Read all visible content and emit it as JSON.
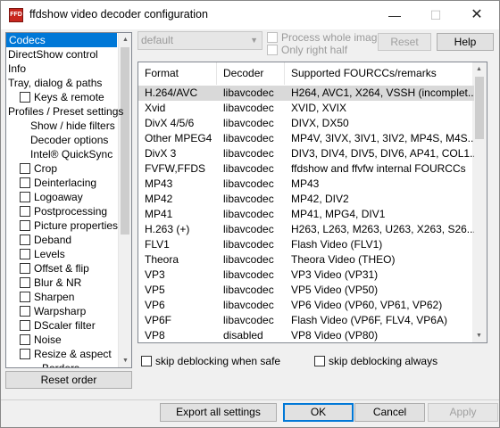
{
  "window": {
    "title": "ffdshow video decoder configuration",
    "icon_text": "FFD"
  },
  "titlebar_buttons": {
    "minimize": "—",
    "maximize": "☐",
    "close": "✕"
  },
  "tree": {
    "items": [
      {
        "label": "Codecs",
        "selected": true,
        "checkbox": false,
        "indent": 0
      },
      {
        "label": "DirectShow control",
        "checkbox": false,
        "indent": 0
      },
      {
        "label": "Info",
        "checkbox": false,
        "indent": 0
      },
      {
        "label": "Tray, dialog & paths",
        "checkbox": false,
        "indent": 0
      },
      {
        "label": "Keys & remote",
        "checkbox": true,
        "indent": 1
      },
      {
        "label": "Profiles / Preset settings",
        "checkbox": false,
        "indent": 0
      },
      {
        "label": "Show / hide filters",
        "checkbox": false,
        "indent": 2
      },
      {
        "label": "Decoder options",
        "checkbox": false,
        "indent": 2
      },
      {
        "label": "Intel® QuickSync",
        "checkbox": false,
        "indent": 2
      },
      {
        "label": "Crop",
        "checkbox": true,
        "indent": 1
      },
      {
        "label": "Deinterlacing",
        "checkbox": true,
        "indent": 1
      },
      {
        "label": "Logoaway",
        "checkbox": true,
        "indent": 1
      },
      {
        "label": "Postprocessing",
        "checkbox": true,
        "indent": 1
      },
      {
        "label": "Picture properties",
        "checkbox": true,
        "indent": 1
      },
      {
        "label": "Deband",
        "checkbox": true,
        "indent": 1
      },
      {
        "label": "Levels",
        "checkbox": true,
        "indent": 1
      },
      {
        "label": "Offset & flip",
        "checkbox": true,
        "indent": 1
      },
      {
        "label": "Blur & NR",
        "checkbox": true,
        "indent": 1
      },
      {
        "label": "Sharpen",
        "checkbox": true,
        "indent": 1
      },
      {
        "label": "Warpsharp",
        "checkbox": true,
        "indent": 1
      },
      {
        "label": "DScaler filter",
        "checkbox": true,
        "indent": 1
      },
      {
        "label": "Noise",
        "checkbox": true,
        "indent": 1
      },
      {
        "label": "Resize & aspect",
        "checkbox": true,
        "indent": 1
      },
      {
        "label": "Borders",
        "checkbox": false,
        "indent": 3
      }
    ]
  },
  "reset_order_label": "Reset order",
  "preset_combo": {
    "value": "default"
  },
  "options": {
    "process_whole_image": "Process whole image",
    "only_right_half": "Only right half"
  },
  "reset_label": "Reset",
  "help_label": "Help",
  "codec_table": {
    "headers": [
      "Format",
      "Decoder",
      "Supported FOURCCs/remarks"
    ],
    "rows": [
      [
        "H.264/AVC",
        "libavcodec",
        "H264, AVC1, X264, VSSH (incomplet..."
      ],
      [
        "Xvid",
        "libavcodec",
        "XVID, XVIX"
      ],
      [
        "DivX 4/5/6",
        "libavcodec",
        "DIVX, DX50"
      ],
      [
        "Other MPEG4",
        "libavcodec",
        "MP4V, 3IVX, 3IV1, 3IV2, MP4S, M4S..."
      ],
      [
        "DivX 3",
        "libavcodec",
        "DIV3, DIV4, DIV5, DIV6, AP41, COL1..."
      ],
      [
        "FVFW,FFDS",
        "libavcodec",
        "ffdshow and ffvfw internal FOURCCs"
      ],
      [
        "MP43",
        "libavcodec",
        "MP43"
      ],
      [
        "MP42",
        "libavcodec",
        "MP42, DIV2"
      ],
      [
        "MP41",
        "libavcodec",
        "MP41, MPG4, DIV1"
      ],
      [
        "H.263 (+)",
        "libavcodec",
        "H263, L263, M263, U263, X263, S26..."
      ],
      [
        "FLV1",
        "libavcodec",
        "Flash Video (FLV1)"
      ],
      [
        "Theora",
        "libavcodec",
        "Theora Video (THEO)"
      ],
      [
        "VP3",
        "libavcodec",
        "VP3 Video (VP31)"
      ],
      [
        "VP5",
        "libavcodec",
        "VP5 Video (VP50)"
      ],
      [
        "VP6",
        "libavcodec",
        "VP6 Video (VP60, VP61, VP62)"
      ],
      [
        "VP6F",
        "libavcodec",
        "Flash Video (VP6F, FLV4, VP6A)"
      ],
      [
        "VP8",
        "disabled",
        "VP8 Video (VP80)"
      ]
    ],
    "selected_row": 0
  },
  "skip_deblocking_safe": "skip deblocking when safe",
  "skip_deblocking_always": "skip deblocking always",
  "footer": {
    "export_label": "Export all settings",
    "ok_label": "OK",
    "cancel_label": "Cancel",
    "apply_label": "Apply"
  }
}
